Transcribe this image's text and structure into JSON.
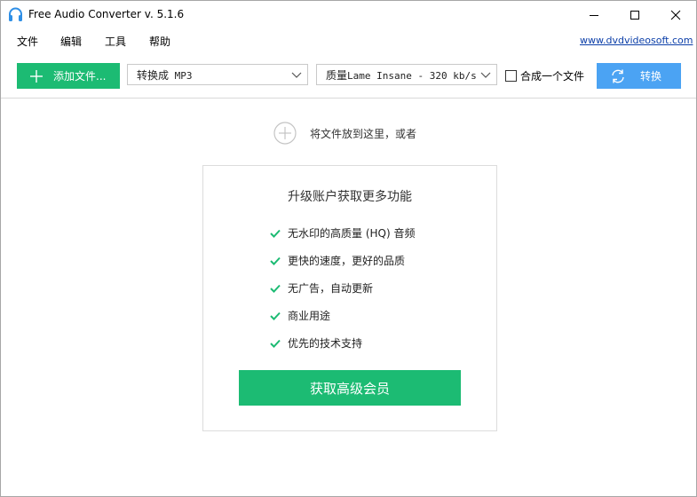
{
  "window": {
    "title": "Free Audio Converter v. 5.1.6",
    "icon": "headphones-icon"
  },
  "menu": {
    "file": "文件",
    "edit": "编辑",
    "tools": "工具",
    "help": "帮助",
    "website": "www.dvdvideosoft.com"
  },
  "toolbar": {
    "add_files": "添加文件...",
    "format_prefix": "转换成",
    "format_value": "MP3",
    "quality_prefix": "质量",
    "quality_value": "Lame Insane - 320 kb/s",
    "merge_label": "合成一个文件",
    "merge_checked": false,
    "convert": "转换"
  },
  "drop": {
    "text": "将文件放到这里，或者"
  },
  "upgrade": {
    "title": "升级账户获取更多功能",
    "features": [
      "无水印的高质量 (HQ) 音频",
      "更快的速度，更好的品质",
      "无广告，自动更新",
      "商业用途",
      "优先的技术支持"
    ],
    "button": "获取高级会员"
  },
  "colors": {
    "green": "#1cbb73",
    "blue": "#4ba3f3",
    "link": "#0b3ea8",
    "check": "#1cbb73"
  }
}
